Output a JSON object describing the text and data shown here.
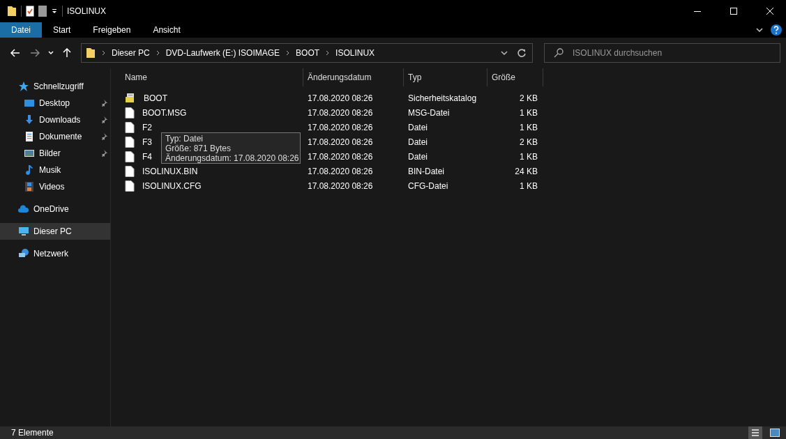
{
  "window": {
    "title": "ISOLINUX"
  },
  "ribbon_tabs": [
    {
      "label": "Datei",
      "selected": true
    },
    {
      "label": "Start",
      "selected": false
    },
    {
      "label": "Freigeben",
      "selected": false
    },
    {
      "label": "Ansicht",
      "selected": false
    }
  ],
  "address_bar": {
    "breadcrumbs": [
      "Dieser PC",
      "DVD-Laufwerk (E:) ISOIMAGE",
      "BOOT",
      "ISOLINUX"
    ]
  },
  "search": {
    "placeholder": "ISOLINUX durchsuchen"
  },
  "sidebar": {
    "items": [
      {
        "label": "Schnellzugriff",
        "kind": "quick",
        "selected": false,
        "children": [
          {
            "label": "Desktop",
            "kind": "desktop",
            "pinned": true,
            "selected": false
          },
          {
            "label": "Downloads",
            "kind": "downloads",
            "pinned": true,
            "selected": false
          },
          {
            "label": "Dokumente",
            "kind": "documents",
            "pinned": true,
            "selected": false
          },
          {
            "label": "Bilder",
            "kind": "pictures",
            "pinned": true,
            "selected": false
          },
          {
            "label": "Musik",
            "kind": "music",
            "pinned": false,
            "selected": false
          },
          {
            "label": "Videos",
            "kind": "videos",
            "pinned": false,
            "selected": false
          }
        ]
      },
      {
        "label": "OneDrive",
        "kind": "cloud",
        "selected": false
      },
      {
        "label": "Dieser PC",
        "kind": "pc",
        "selected": true
      },
      {
        "label": "Netzwerk",
        "kind": "network",
        "selected": false
      }
    ]
  },
  "table": {
    "columns": [
      "Name",
      "Änderungsdatum",
      "Typ",
      "Größe"
    ],
    "rows": [
      {
        "name": "BOOT",
        "kind": "catalog",
        "date": "17.08.2020 08:26",
        "type": "Sicherheitskatalog",
        "size": "2 KB"
      },
      {
        "name": "BOOT.MSG",
        "kind": "file",
        "date": "17.08.2020 08:26",
        "type": "MSG-Datei",
        "size": "1 KB"
      },
      {
        "name": "F2",
        "kind": "file",
        "date": "17.08.2020 08:26",
        "type": "Datei",
        "size": "1 KB"
      },
      {
        "name": "F3",
        "kind": "file",
        "date": "17.08.2020 08:26",
        "type": "Datei",
        "size": "2 KB"
      },
      {
        "name": "F4",
        "kind": "file",
        "date": "17.08.2020 08:26",
        "type": "Datei",
        "size": "1 KB"
      },
      {
        "name": "ISOLINUX.BIN",
        "kind": "file",
        "date": "17.08.2020 08:26",
        "type": "BIN-Datei",
        "size": "24 KB"
      },
      {
        "name": "ISOLINUX.CFG",
        "kind": "file",
        "date": "17.08.2020 08:26",
        "type": "CFG-Datei",
        "size": "1 KB"
      }
    ]
  },
  "tooltip": {
    "lines": [
      "Typ: Datei",
      "Größe: 871 Bytes",
      "Änderungsdatum: 17.08.2020 08:26"
    ]
  },
  "status_bar": {
    "text": "7 Elemente"
  }
}
